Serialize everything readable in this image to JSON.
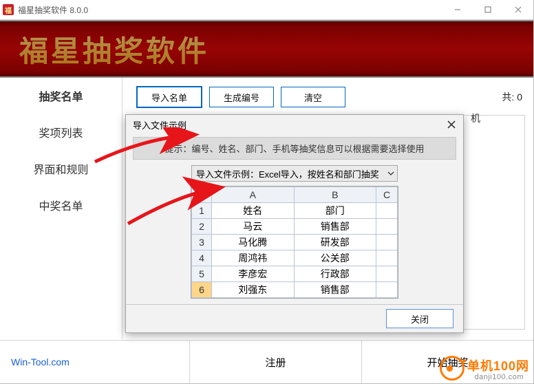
{
  "titlebar": {
    "app_icon_char": "福",
    "title": "福星抽奖软件 8.0.0"
  },
  "banner": {
    "text": "福星抽奖软件"
  },
  "sidebar": {
    "items": [
      {
        "label": "抽奖名单"
      },
      {
        "label": "奖项列表"
      },
      {
        "label": "界面和规则"
      },
      {
        "label": "中奖名单"
      }
    ]
  },
  "toolbar": {
    "import_label": "导入名单",
    "generate_label": "生成编号",
    "clear_label": "清空",
    "total_prefix": "共:",
    "total_value": "0"
  },
  "peek_column": "机",
  "dialog": {
    "title": "导入文件示例",
    "hint": "提示：编号、姓名、部门、手机等抽奖信息可以根据需要选择使用",
    "select_label": "导入文件示例：Excel导入，按姓名和部门抽奖",
    "columns": [
      "A",
      "B",
      "C"
    ],
    "rows": [
      {
        "n": "1",
        "a": "姓名",
        "b": "部门",
        "c": ""
      },
      {
        "n": "2",
        "a": "马云",
        "b": "销售部",
        "c": ""
      },
      {
        "n": "3",
        "a": "马化腾",
        "b": "研发部",
        "c": ""
      },
      {
        "n": "4",
        "a": "周鸿祎",
        "b": "公关部",
        "c": ""
      },
      {
        "n": "5",
        "a": "李彦宏",
        "b": "行政部",
        "c": ""
      },
      {
        "n": "6",
        "a": "刘强东",
        "b": "销售部",
        "c": ""
      }
    ],
    "close_label": "关闭"
  },
  "footer": {
    "link": "Win-Tool.com",
    "register_label": "注册",
    "start_label": "开始抽奖"
  },
  "watermark": {
    "brand": "单机100网",
    "domain": "danji100.com"
  }
}
